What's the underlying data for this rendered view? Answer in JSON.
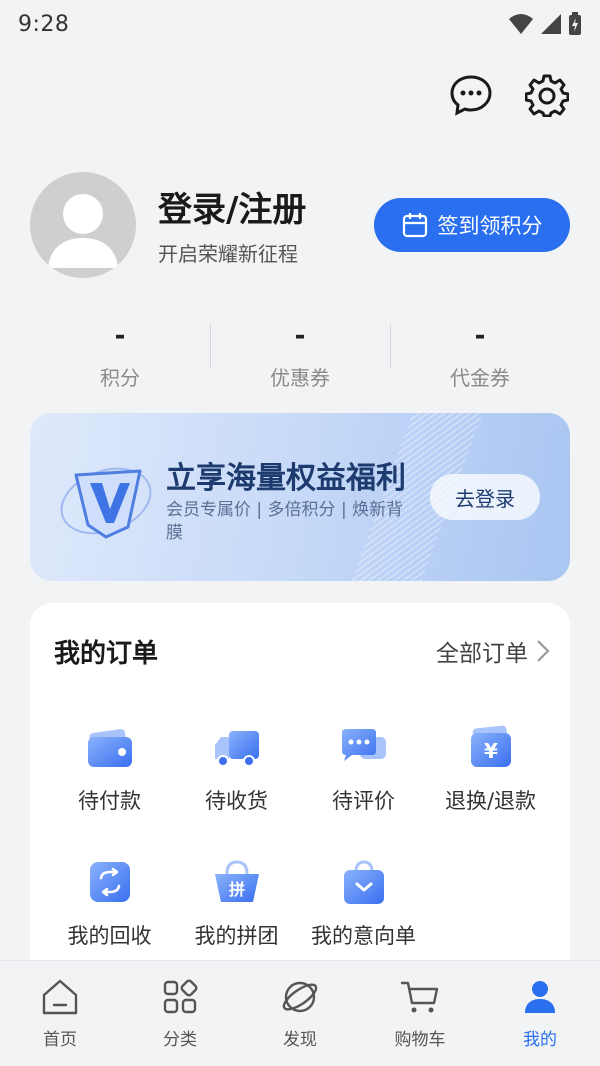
{
  "status_bar": {
    "time": "9:28"
  },
  "profile": {
    "title": "登录/注册",
    "subtitle": "开启荣耀新征程",
    "checkin_label": "签到领积分"
  },
  "stats": [
    {
      "value": "-",
      "label": "积分"
    },
    {
      "value": "-",
      "label": "优惠券"
    },
    {
      "value": "-",
      "label": "代金券"
    }
  ],
  "banner": {
    "title": "立享海量权益福利",
    "description": "会员专属价 | 多倍积分 | 焕新背膜",
    "button_label": "去登录"
  },
  "orders": {
    "title": "我的订单",
    "all_label": "全部订单",
    "items": [
      {
        "label": "待付款",
        "icon": "wallet-icon"
      },
      {
        "label": "待收货",
        "icon": "truck-icon"
      },
      {
        "label": "待评价",
        "icon": "chat-bubble-icon"
      },
      {
        "label": "退换/退款",
        "icon": "refund-icon"
      },
      {
        "label": "我的回收",
        "icon": "recycle-icon"
      },
      {
        "label": "我的拼团",
        "icon": "group-buy-basket-icon"
      },
      {
        "label": "我的意向单",
        "icon": "shopping-bag-icon"
      }
    ]
  },
  "bottom_nav": {
    "items": [
      {
        "label": "首页",
        "icon": "home-icon"
      },
      {
        "label": "分类",
        "icon": "category-grid-icon"
      },
      {
        "label": "发现",
        "icon": "planet-icon"
      },
      {
        "label": "购物车",
        "icon": "cart-icon"
      },
      {
        "label": "我的",
        "icon": "person-icon",
        "active": true
      }
    ]
  },
  "colors": {
    "accent": "#2a6ff0",
    "background": "#f1f3f5"
  }
}
